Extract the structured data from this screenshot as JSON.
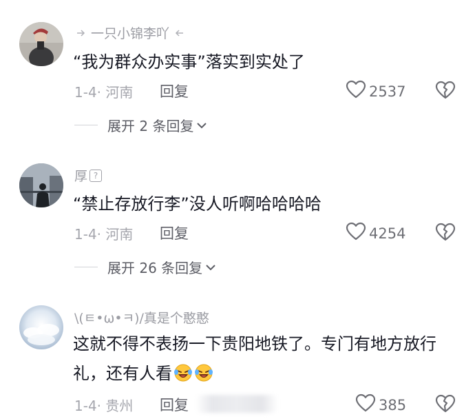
{
  "comments": [
    {
      "username": "一只小锦李吖",
      "text": "“我为群众办实事”落实到实处了",
      "date": "1-4",
      "location": "河南",
      "reply_label": "回复",
      "likes": "2537",
      "expand_label": "展开 2 条回复"
    },
    {
      "username": "厚",
      "text": "“禁止存放行李”没人听啊哈哈哈哈",
      "date": "1-4",
      "location": "河南",
      "reply_label": "回复",
      "likes": "4254",
      "expand_label": "展开 26 条回复"
    },
    {
      "username": "\\(ㅌ•ω•ㅋ)/真是个憨憨",
      "text": "这就不得不表扬一下贵阳地铁了。专门有地方放行礼，还有人看",
      "date": "1-4",
      "location": "贵州",
      "reply_label": "回复",
      "likes": "385"
    }
  ],
  "colors": {
    "text_primary": "#161823",
    "text_muted": "#a5a6ad",
    "icon_gray": "#6d6e74"
  },
  "icons": {
    "like": "heart-outline-icon",
    "dislike": "broken-heart-icon",
    "expand": "chevron-down-icon",
    "emoji": "laugh-cry-emoji"
  }
}
